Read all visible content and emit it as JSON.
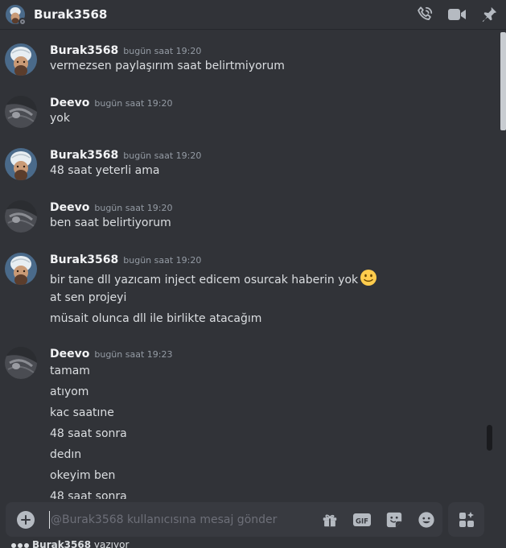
{
  "header": {
    "title": "Burak3568"
  },
  "messages": [
    {
      "author": "Burak3568",
      "avatar": "burak",
      "time": "bugün saat 19:20",
      "lines": [
        "vermezsen paylaşırım saat belirtmiyorum"
      ]
    },
    {
      "author": "Deevo",
      "avatar": "deevo",
      "time": "bugün saat 19:20",
      "lines": [
        "yok"
      ]
    },
    {
      "author": "Burak3568",
      "avatar": "burak",
      "time": "bugün saat 19:20",
      "lines": [
        "48 saat yeterli ama"
      ]
    },
    {
      "author": "Deevo",
      "avatar": "deevo",
      "time": "bugün saat 19:20",
      "lines": [
        "ben saat belirtiyorum"
      ]
    },
    {
      "author": "Burak3568",
      "avatar": "burak",
      "time": "bugün saat 19:20",
      "lines": [
        "bir tane dll yazıcam inject edicem osurcak haberin yok",
        "at sen projeyi",
        "müsait olunca dll ile birlikte atacağım"
      ]
    },
    {
      "author": "Deevo",
      "avatar": "deevo",
      "time": "bugün saat 19:23",
      "lines": [
        "tamam",
        "atıyom",
        "kac saatıne",
        "48 saat sonra",
        "dedın",
        "okeyim ben",
        "48 saat sonra"
      ]
    }
  ],
  "emoji": "slightly-smiling-face-icon",
  "composer": {
    "placeholder": "@Burak3568 kullanıcısına mesaj gönder"
  },
  "typing": {
    "name": "Burak3568",
    "suffix": "yazıyor"
  },
  "colors": {
    "background": "#313338",
    "composer": "#383a40",
    "text": "#dbdee1",
    "muted": "#949ba4"
  }
}
